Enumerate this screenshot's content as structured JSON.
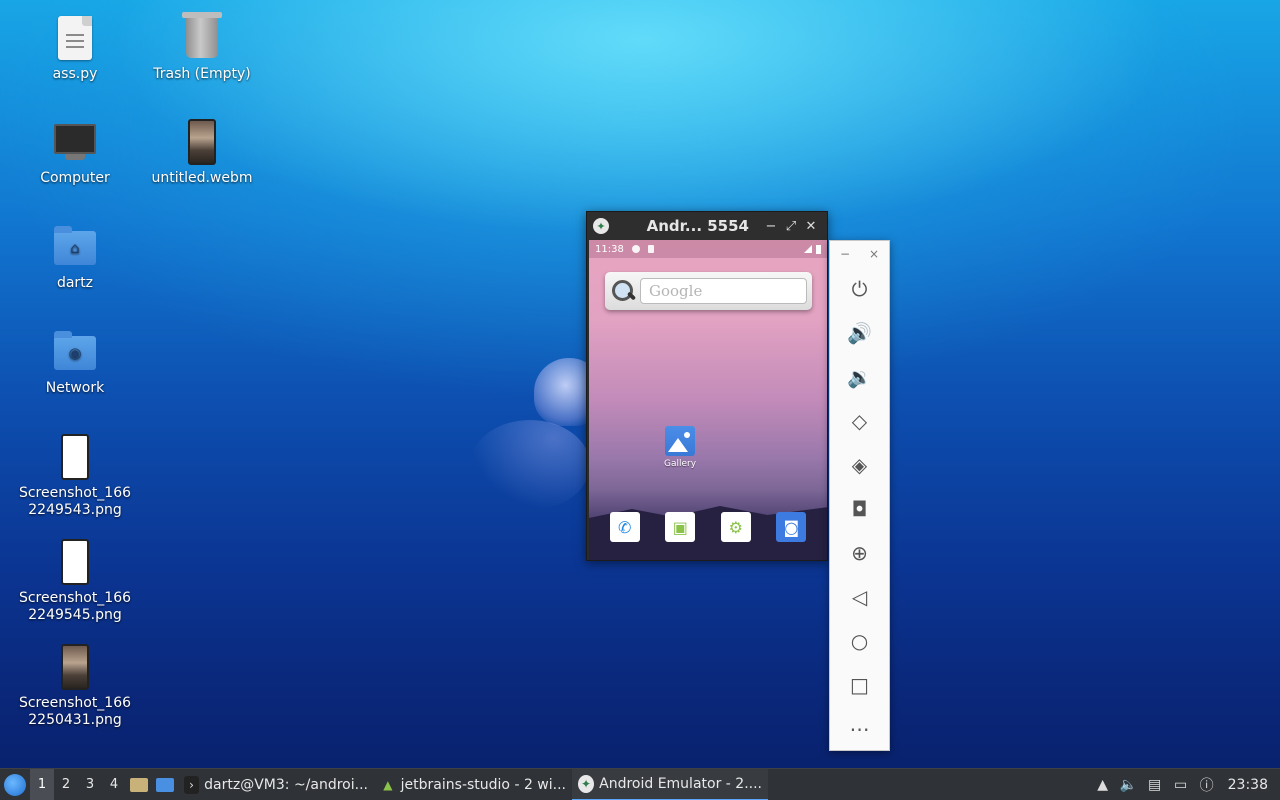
{
  "desktop": {
    "icons": [
      {
        "label": "ass.py"
      },
      {
        "label": "Trash (Empty)"
      },
      {
        "label": "Computer"
      },
      {
        "label": "untitled.webm"
      },
      {
        "label": "dartz"
      },
      {
        "label": "Network"
      },
      {
        "label": "Screenshot_166\n2249543.png"
      },
      {
        "label": "Screenshot_166\n2249545.png"
      },
      {
        "label": "Screenshot_166\n2250431.png"
      }
    ]
  },
  "emulator": {
    "title": "Andr... 5554",
    "controls": {
      "minimize": "−",
      "maximize": "⤢",
      "close": "✕"
    },
    "statusbar": {
      "time": "11:38"
    },
    "search": {
      "placeholder": "Google"
    },
    "home_apps": {
      "gallery": "Gallery"
    }
  },
  "side_panel": {
    "minimize": "−",
    "close": "×",
    "buttons": [
      "power-icon",
      "volume-up-icon",
      "volume-down-icon",
      "rotate-left-icon",
      "rotate-right-icon",
      "camera-icon",
      "zoom-icon",
      "back-icon",
      "home-icon",
      "overview-icon",
      "more-icon"
    ]
  },
  "taskbar": {
    "workspaces": [
      "1",
      "2",
      "3",
      "4"
    ],
    "active_workspace": "1",
    "tasks": [
      {
        "label": "dartz@VM3: ~/androi..."
      },
      {
        "label": "jetbrains-studio - 2 wi..."
      },
      {
        "label": "Android Emulator - 2...."
      }
    ],
    "clock": "23:38"
  },
  "colors": {
    "taskbar_bg": "#2f3236",
    "active_task_accent": "#5aa7ff",
    "camera_dock": "#3d7be0"
  }
}
